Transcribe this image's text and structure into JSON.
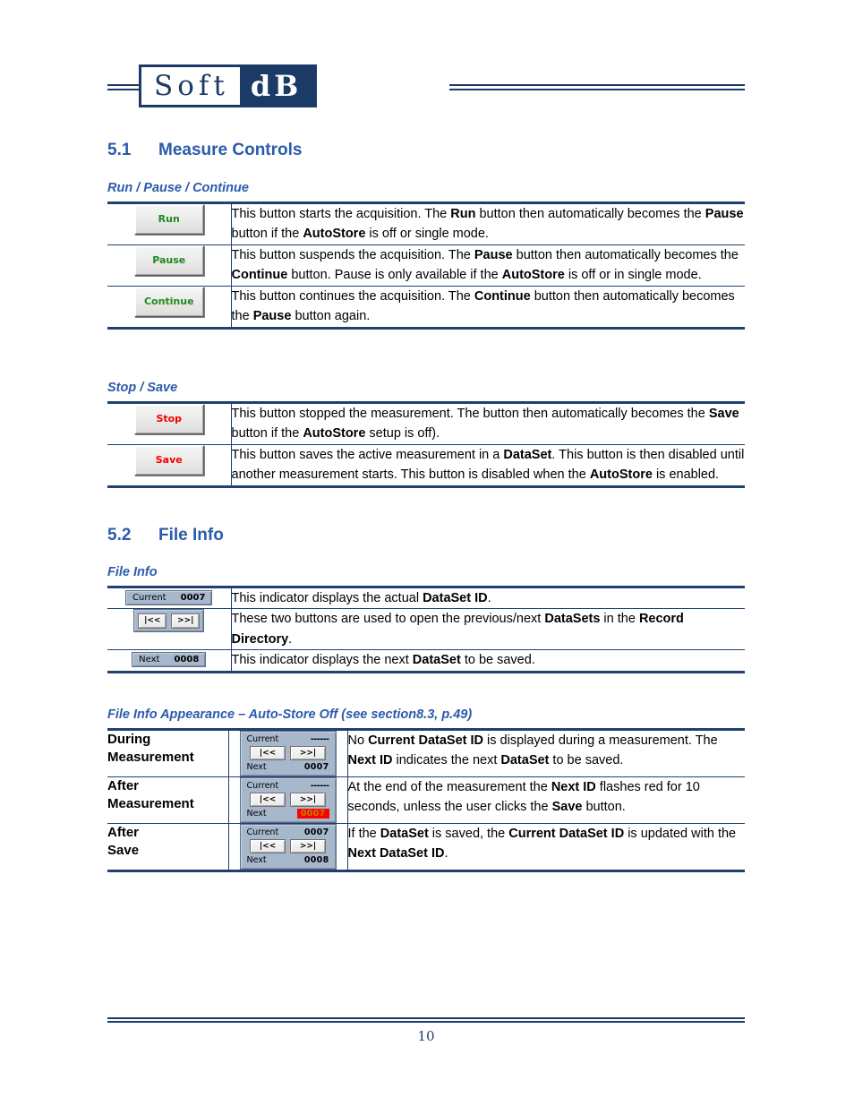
{
  "brand": {
    "logo_left": "Soft",
    "logo_right": "dB"
  },
  "sections": [
    {
      "number": "5.1",
      "title": "Measure Controls",
      "groups": [
        {
          "heading": "Run / Pause / Continue",
          "rows": [
            {
              "button": {
                "label": "Run",
                "color": "green"
              },
              "desc_html": "This button starts the acquisition. The <b>Run</b> button then automatically becomes the <b>Pause</b> button if the <b>AutoStore</b> is off or single mode."
            },
            {
              "button": {
                "label": "Pause",
                "color": "green"
              },
              "desc_html": "This button suspends the acquisition. The <b>Pause</b> button then automatically becomes the <b>Continue</b> button. Pause is only available if the <b>AutoStore</b> is off or in single mode."
            },
            {
              "button": {
                "label": "Continue",
                "color": "green"
              },
              "desc_html": "This button continues the acquisition. The <b>Continue</b> button then automatically becomes the <b>Pause</b> button again."
            }
          ]
        },
        {
          "heading": "Stop / Save",
          "rows": [
            {
              "button": {
                "label": "Stop",
                "color": "red"
              },
              "desc_html": "This button stopped the measurement. The button then automatically becomes the <b>Save</b> button if the <b>AutoStore</b> setup is off)."
            },
            {
              "button": {
                "label": "Save",
                "color": "red"
              },
              "desc_html": "This button saves the active measurement in a <b>DataSet</b>. This button is then disabled until another measurement starts. This button is disabled when the <b>AutoStore</b> is enabled."
            }
          ]
        }
      ]
    },
    {
      "number": "5.2",
      "title": "File Info",
      "groups": [
        {
          "heading": "File Info",
          "rows": [
            {
              "widget": {
                "type": "chip",
                "key": "Current",
                "value": "0007"
              },
              "desc_html": "This indicator displays the actual <b>DataSet ID</b>."
            },
            {
              "widget": {
                "type": "navpair",
                "prev_label": "|<<",
                "next_label": ">>|"
              },
              "desc_html": "These two buttons are used to open the previous/next <b>DataSets</b> in the <b>Record Directory</b>."
            },
            {
              "widget": {
                "type": "chip",
                "key": "Next",
                "value": "0008"
              },
              "desc_html": "This indicator displays the next <b>DataSet</b> to be saved."
            }
          ]
        },
        {
          "heading": "File Info Appearance – Auto-Store Off (see section8.3, p.49)",
          "rows": [
            {
              "label": "During\nMeasurement",
              "panel": {
                "current_key": "Current",
                "current_value": "------",
                "prev_label": "|<<",
                "next_btn_label": ">>|",
                "next_key": "Next",
                "next_value": "0007",
                "next_flash": false
              },
              "desc_html": "No <b>Current DataSet ID</b> is displayed during a measurement. The <b>Next ID</b> indicates the next <b>DataSet</b> to be saved."
            },
            {
              "label": "After\nMeasurement",
              "panel": {
                "current_key": "Current",
                "current_value": "------",
                "prev_label": "|<<",
                "next_btn_label": ">>|",
                "next_key": "Next",
                "next_value": "0007",
                "next_flash": true
              },
              "desc_html": "At the end of the measurement the <b>Next ID</b> flashes red for 10 seconds, unless the user clicks the <b>Save</b> button."
            },
            {
              "label": "After\nSave",
              "panel": {
                "current_key": "Current",
                "current_value": "0007",
                "prev_label": "|<<",
                "next_btn_label": ">>|",
                "next_key": "Next",
                "next_value": "0008",
                "next_flash": false
              },
              "desc_html": "If the <b>DataSet</b> is saved, the <b>Current DataSet ID</b> is updated with the <b>Next DataSet ID</b>."
            }
          ]
        }
      ]
    }
  ],
  "footer": {
    "page_number": "10"
  },
  "colors": {
    "navy": "#1b3b66",
    "heading_blue": "#2b5bab",
    "rule_blue": "#1f4070",
    "button_green": "#1e8a1e",
    "button_red": "#f20000",
    "chip_bg": "#a8b8cc",
    "flash_red": "#ff0000"
  }
}
